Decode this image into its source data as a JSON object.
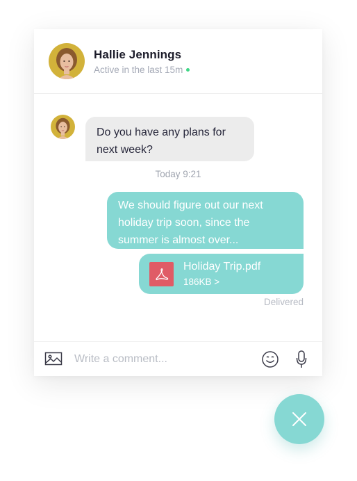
{
  "contact": {
    "name": "Hallie Jennings",
    "status": "Active in the last 15m",
    "online_color": "#3fd686"
  },
  "messages": {
    "incoming_text": "Do you have any plans for next week?",
    "timestamp": "Today 9:21",
    "outgoing_text": "We should figure out our next holiday trip soon, since the summer is almost over...",
    "attachment": {
      "name": "Holiday Trip.pdf",
      "size": "186KB >",
      "icon": "pdf-icon"
    },
    "delivery_status": "Delivered"
  },
  "composer": {
    "placeholder": "Write a comment...",
    "icons": [
      "image-icon",
      "emoji-icon",
      "microphone-icon"
    ]
  },
  "fab": {
    "icon": "close-icon"
  },
  "colors": {
    "accent": "#86d8d3",
    "incoming_bubble": "#ececec",
    "pdf_red": "#e05b66"
  }
}
